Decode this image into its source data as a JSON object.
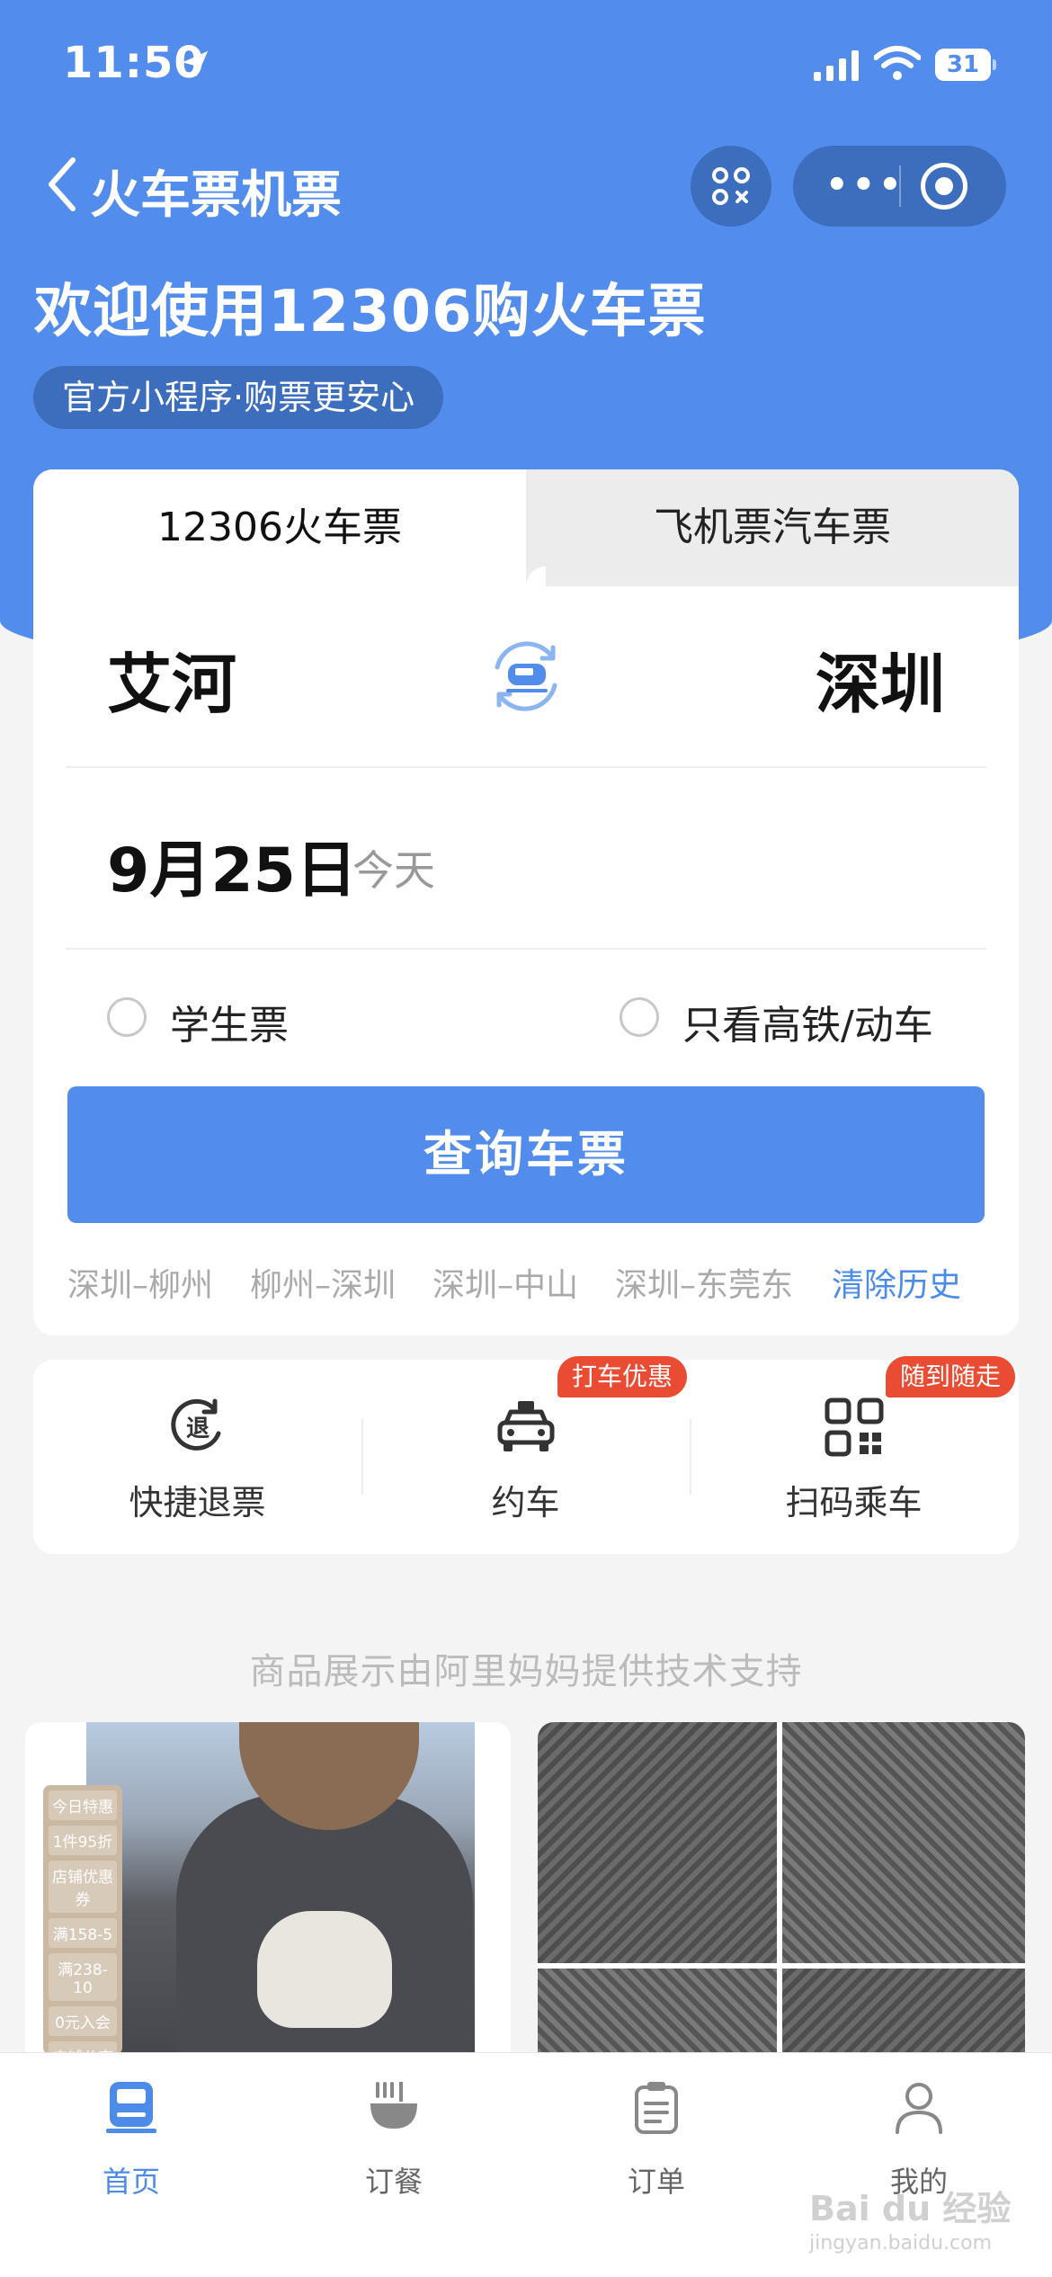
{
  "status": {
    "time": "11:50",
    "battery": "31"
  },
  "nav": {
    "title": "火车票机票"
  },
  "hero": {
    "welcome": "欢迎使用12306购火车票",
    "tag": "官方小程序·购票更安心"
  },
  "tabs": [
    {
      "label": "12306火车票",
      "active": true
    },
    {
      "label": "飞机票汽车票",
      "active": false
    }
  ],
  "search": {
    "from": "艾河",
    "to": "深圳",
    "date": "9月25日",
    "date_sub": "今天",
    "options": [
      {
        "label": "学生票",
        "checked": false
      },
      {
        "label": "只看高铁/动车",
        "checked": false
      }
    ],
    "button": "查询车票"
  },
  "history": [
    "深圳–柳州",
    "柳州–深圳",
    "深圳–中山",
    "深圳–东莞东"
  ],
  "history_clear": "清除历史",
  "services": [
    {
      "label": "快捷退票",
      "icon": "refund-icon",
      "badge": ""
    },
    {
      "label": "约车",
      "icon": "taxi-icon",
      "badge": "打车优惠"
    },
    {
      "label": "扫码乘车",
      "icon": "qr-code-icon",
      "badge": "随到随走"
    }
  ],
  "ali_note": "商品展示由阿里妈妈提供技术支持",
  "promo": {
    "title": "今日特惠",
    "items": [
      "1件95折",
      "店铺优惠券",
      "满158-5",
      "满238-10",
      "0元入会",
      "店铺分享券"
    ]
  },
  "tabbar": [
    {
      "label": "首页",
      "icon": "train-home-icon",
      "active": true
    },
    {
      "label": "订餐",
      "icon": "meal-bowl-icon",
      "active": false
    },
    {
      "label": "订单",
      "icon": "order-list-icon",
      "active": false
    },
    {
      "label": "我的",
      "icon": "user-profile-icon",
      "active": false
    }
  ],
  "watermark": {
    "text": "Bai du 经验",
    "sub": "jingyan.baidu.com"
  },
  "colors": {
    "primary": "#528cec",
    "primary_dark": "#3d6dbd",
    "badge": "#ea4b33"
  }
}
